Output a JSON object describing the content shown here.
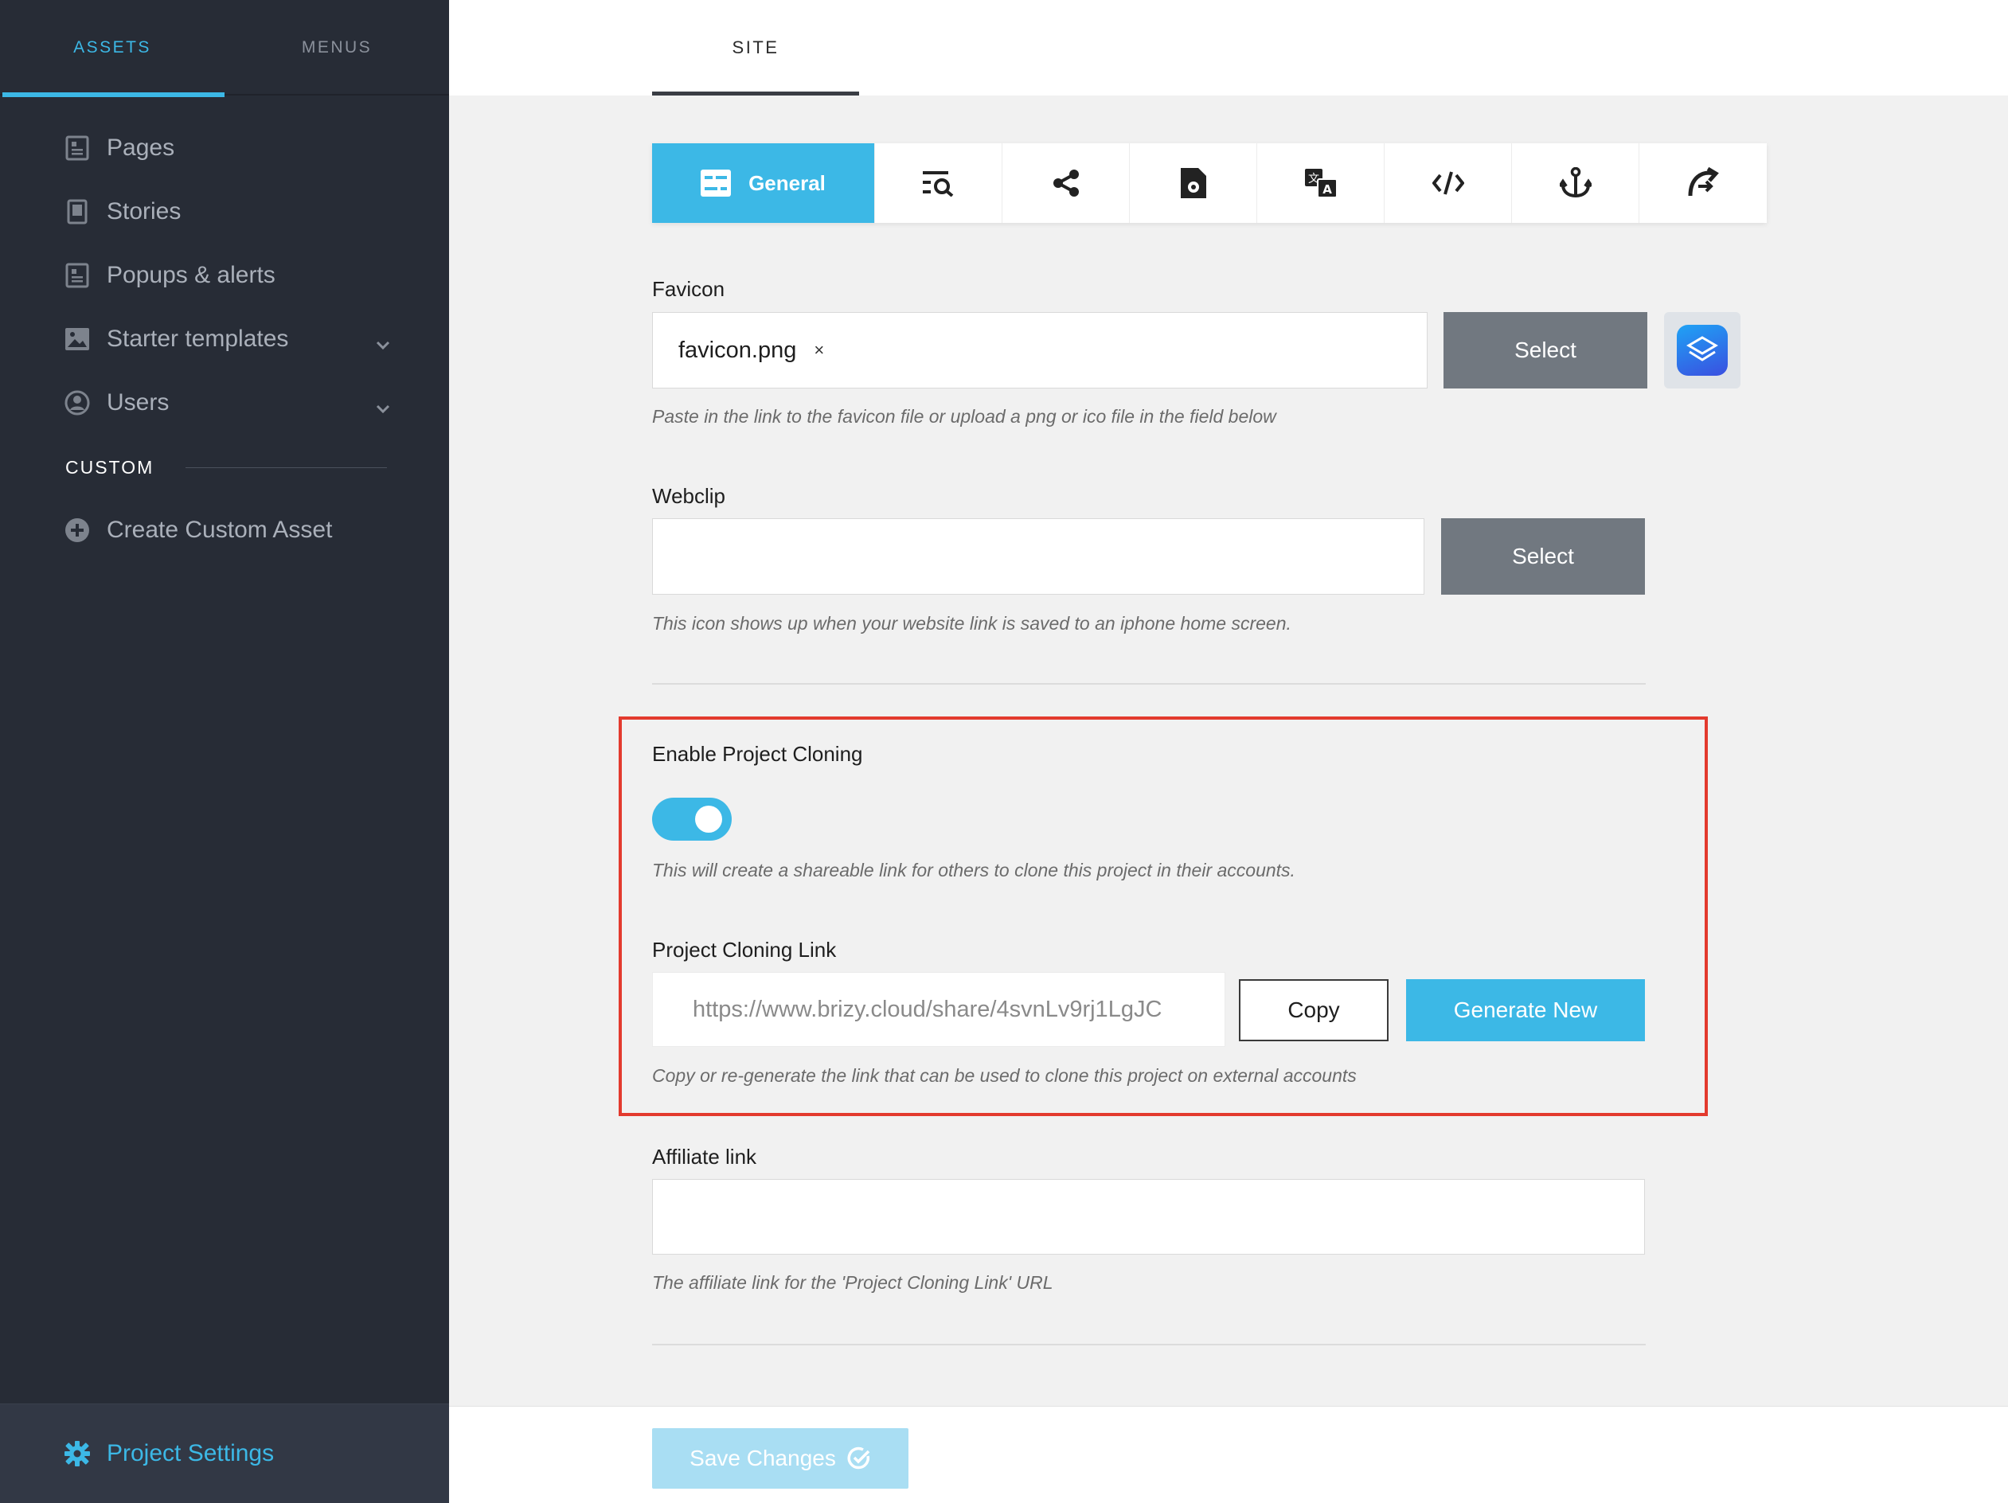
{
  "sidebar": {
    "tabs": [
      "ASSETS",
      "MENUS"
    ],
    "items": [
      {
        "label": "Pages",
        "icon": "page-icon"
      },
      {
        "label": "Stories",
        "icon": "story-icon"
      },
      {
        "label": "Popups & alerts",
        "icon": "popup-icon"
      },
      {
        "label": "Starter templates",
        "icon": "image-icon",
        "expandable": true
      },
      {
        "label": "Users",
        "icon": "user-icon",
        "expandable": true
      }
    ],
    "section_title": "CUSTOM",
    "create_custom_asset": "Create Custom Asset",
    "footer": "Project Settings"
  },
  "header": {
    "tab": "SITE"
  },
  "settings_tabs": {
    "active_label": "General",
    "icons": [
      "general-icon",
      "seo-icon",
      "share-icon",
      "file-settings-icon",
      "translate-icon",
      "code-icon",
      "anchor-icon",
      "redirect-icon"
    ]
  },
  "favicon": {
    "label": "Favicon",
    "value": "favicon.png",
    "remove": "×",
    "select": "Select",
    "help": "Paste in the link to the favicon file or upload a png or ico file in the field below"
  },
  "webclip": {
    "label": "Webclip",
    "select": "Select",
    "help": "This icon shows up when your website link is saved to an iphone home screen."
  },
  "cloning": {
    "label": "Enable Project Cloning",
    "enabled": true,
    "help": "This will create a shareable link for others to clone this project in their accounts.",
    "link_label": "Project Cloning Link",
    "link_value": "https://www.brizy.cloud/share/4svnLv9rj1LgJC",
    "copy": "Copy",
    "generate": "Generate New",
    "link_help": "Copy or re-generate the link that can be used to clone this project on external accounts"
  },
  "affiliate": {
    "label": "Affiliate link",
    "help": "The affiliate link for the 'Project Cloning Link' URL"
  },
  "save": "Save Changes",
  "colors": {
    "accent": "#3cb8e6",
    "sidebar": "#272c36",
    "highlight": "#e33a2e"
  }
}
